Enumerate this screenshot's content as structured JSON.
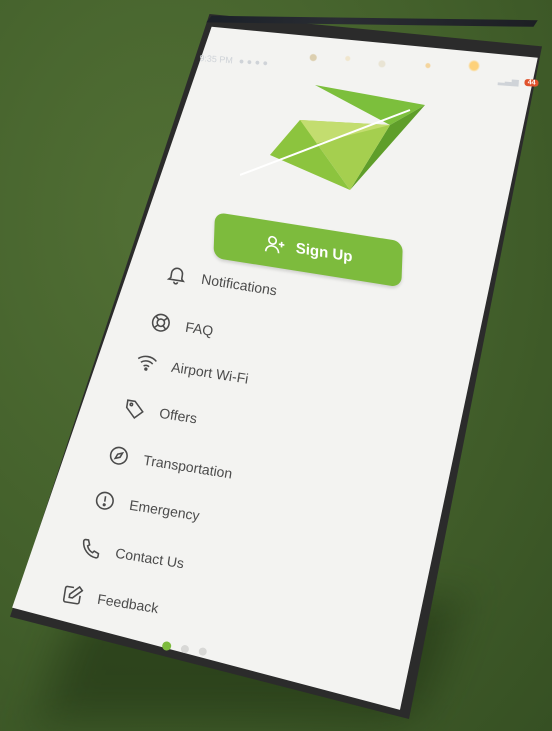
{
  "status_bar": {
    "time": "9:35 PM",
    "battery_badge": "44"
  },
  "signup": {
    "label": "Sign Up"
  },
  "menu": [
    {
      "icon": "bell-icon",
      "label": "Notifications"
    },
    {
      "icon": "lifebuoy-icon",
      "label": "FAQ"
    },
    {
      "icon": "wifi-icon",
      "label": "Airport Wi-Fi"
    },
    {
      "icon": "tag-icon",
      "label": "Offers"
    },
    {
      "icon": "compass-icon",
      "label": "Transportation"
    },
    {
      "icon": "alert-circle-icon",
      "label": "Emergency"
    },
    {
      "icon": "phone-icon",
      "label": "Contact Us"
    },
    {
      "icon": "edit-icon",
      "label": "Feedback"
    }
  ],
  "pager": {
    "pages": 3,
    "active": 0
  },
  "colors": {
    "accent": "#7dbb3d",
    "background": "#47622e",
    "screen": "#f3f3f1",
    "text": "#4b4b4b"
  }
}
